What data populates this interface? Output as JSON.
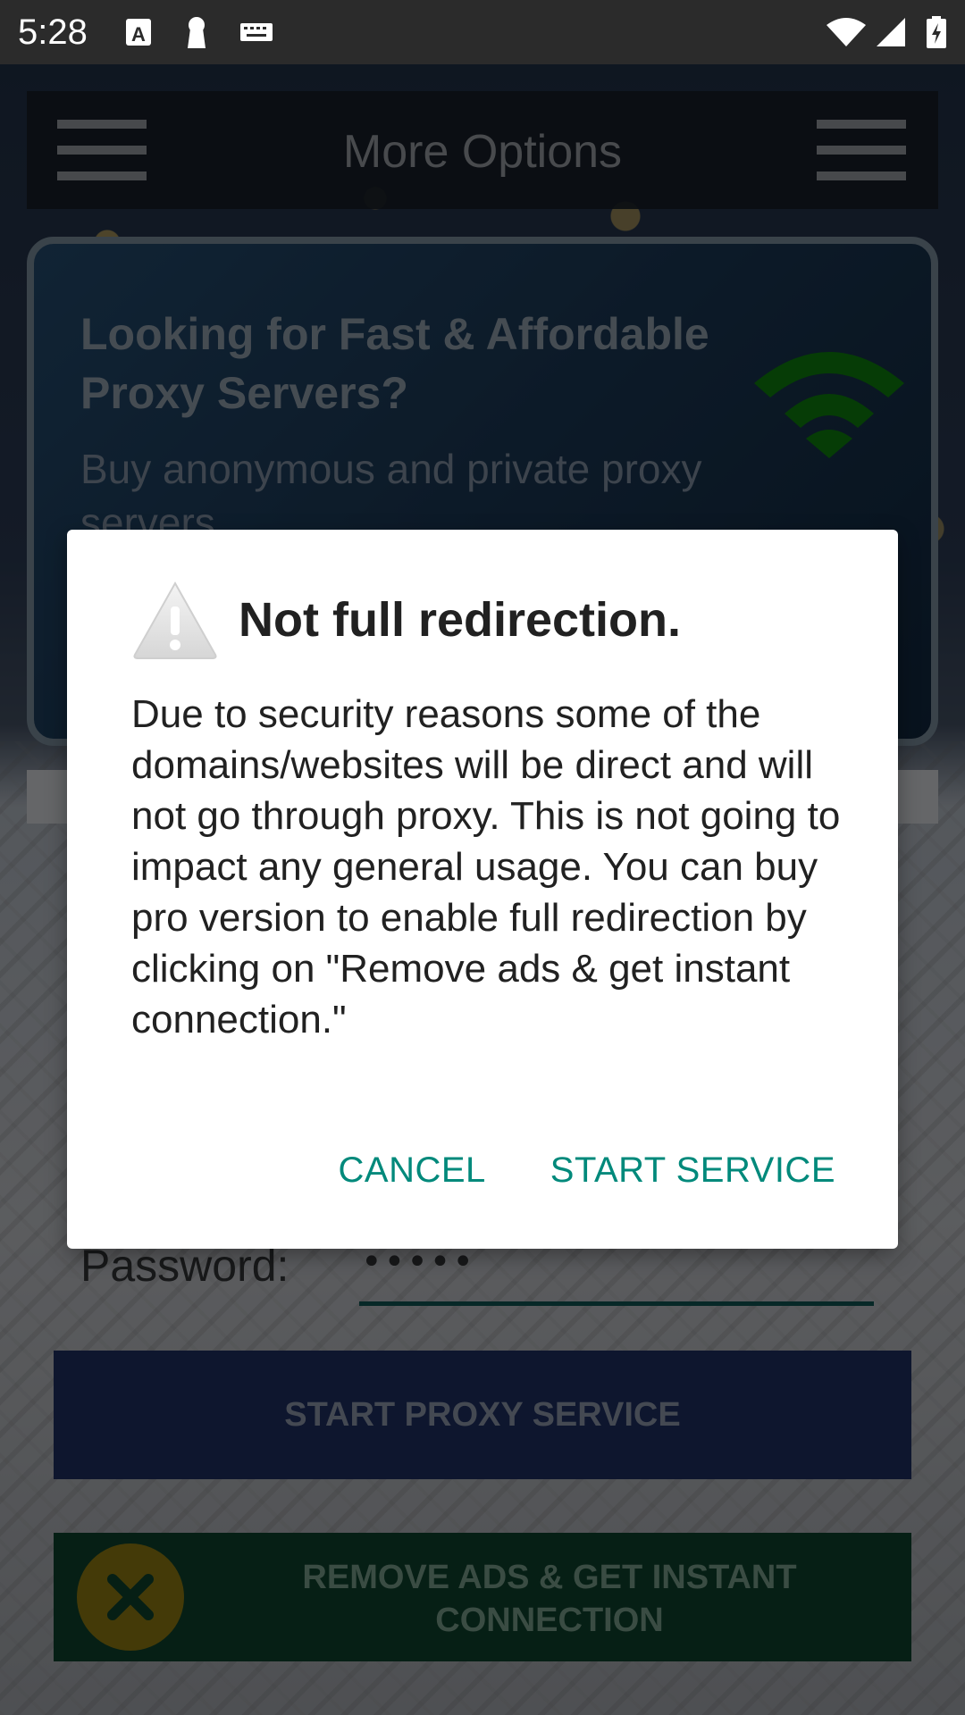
{
  "status_bar": {
    "time": "5:28",
    "icons": [
      "notification-a-icon",
      "keyhole-icon",
      "keyboard-icon",
      "wifi-icon",
      "signal-icon",
      "battery-charging-icon"
    ]
  },
  "top_bar": {
    "title": "More Options",
    "left_icon": "menu-icon",
    "right_icon": "menu-icon"
  },
  "promo": {
    "title": "Looking for Fast & Affordable Proxy Servers?",
    "subtitle": "Buy anonymous and private proxy servers",
    "icon": "wifi-icon",
    "icon_color": "#0b7a0b"
  },
  "form": {
    "password_label": "Password:",
    "password_value": "•••••"
  },
  "buttons": {
    "start_proxy": "START PROXY SERVICE",
    "remove_ads": "REMOVE ADS & GET INSTANT CONNECTION",
    "remove_ads_icon": "close-x-icon"
  },
  "dialog": {
    "icon": "warning-icon",
    "title": "Not full redirection.",
    "message": "Due to security reasons some of the domains/websites will be direct and will not go through proxy. This is not going to impact any general usage. You can buy pro version to enable full redirection by clicking on \"Remove ads & get instant connection.\"",
    "cancel_label": "CANCEL",
    "confirm_label": "START SERVICE",
    "accent_color": "#00897b"
  }
}
